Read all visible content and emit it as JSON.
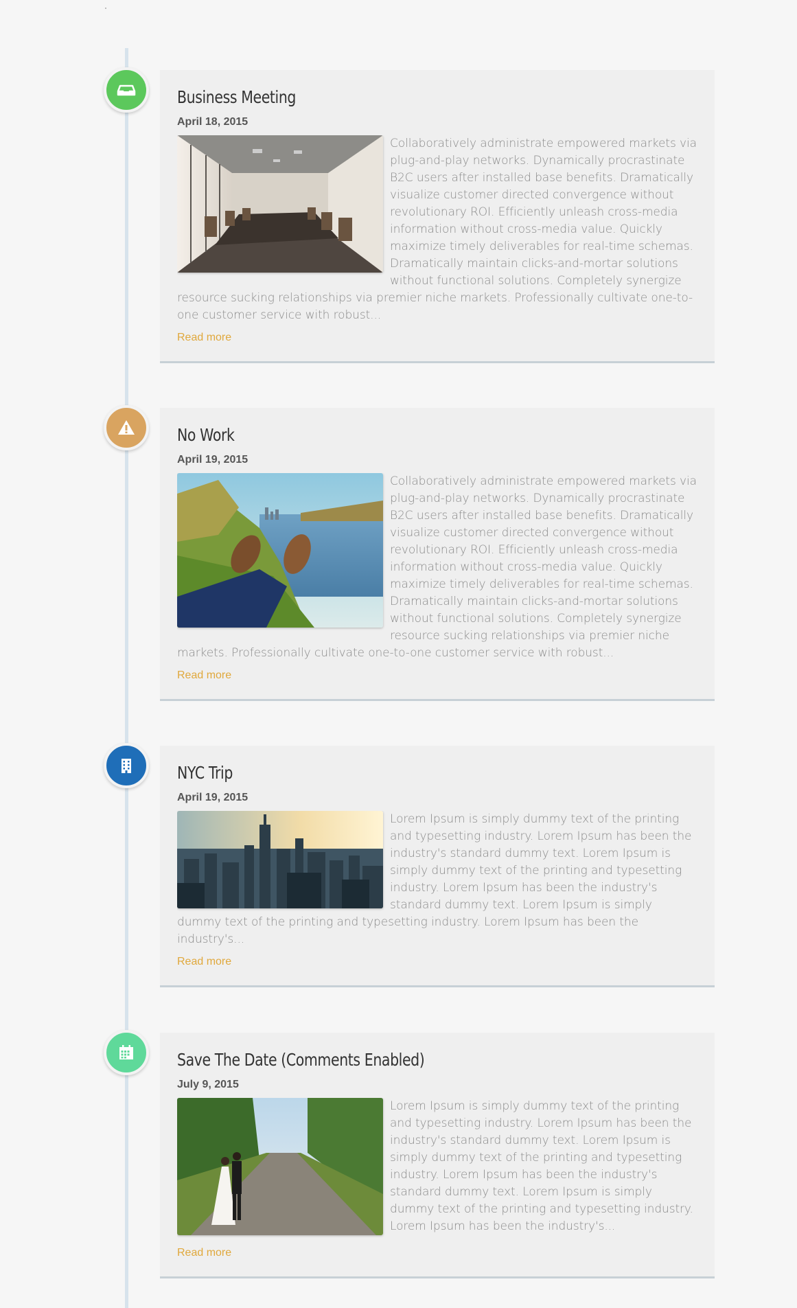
{
  "posts": [
    {
      "icon": "inbox-icon",
      "icon_color": "#5cc85c",
      "title": "Business Meeting",
      "date": "April 18, 2015",
      "image": "conference-room-photo",
      "excerpt": "Collaboratively administrate empowered markets via plug-and-play networks. Dynamically procrastinate B2C users after installed base benefits. Dramatically visualize customer directed convergence without revolutionary ROI. Efficiently unleash cross-media information without cross-media value. Quickly maximize timely deliverables for real-time schemas. Dramatically maintain clicks-and-mortar solutions without functional solutions. Completely synergize resource sucking relationships via premier niche markets. Professionally cultivate one-to-one customer service with robust...",
      "read_more": "Read more"
    },
    {
      "icon": "warning-icon",
      "icon_color": "#d9a460",
      "title": "No Work",
      "date": "April 19, 2015",
      "image": "lakeside-boots-photo",
      "excerpt": "Collaboratively administrate empowered markets via plug-and-play networks. Dynamically procrastinate B2C users after installed base benefits. Dramatically visualize customer directed convergence without revolutionary ROI. Efficiently unleash cross-media information without cross-media value. Quickly maximize timely deliverables for real-time schemas. Dramatically maintain clicks-and-mortar solutions without functional solutions. Completely synergize resource sucking relationships via premier niche markets. Professionally cultivate one-to-one customer service with robust...",
      "read_more": "Read more"
    },
    {
      "icon": "building-icon",
      "icon_color": "#1f6eb8",
      "title": "NYC Trip",
      "date": "April 19, 2015",
      "image": "city-skyline-photo",
      "excerpt": "Lorem Ipsum is simply dummy text of the printing and typesetting industry. Lorem Ipsum has been the industry's standard dummy text. Lorem Ipsum is simply dummy text of the printing and typesetting industry. Lorem Ipsum has been the industry's standard dummy text. Lorem Ipsum is simply dummy text of the printing and typesetting industry. Lorem Ipsum has been the industry's...",
      "read_more": "Read more"
    },
    {
      "icon": "calendar-icon",
      "icon_color": "#5fd99a",
      "title": "Save The Date (Comments Enabled)",
      "date": "July 9, 2015",
      "image": "wedding-couple-photo",
      "excerpt": "Lorem Ipsum is simply dummy text of the printing and typesetting industry. Lorem Ipsum has been the industry's standard dummy text. Lorem Ipsum is simply dummy text of the printing and typesetting industry. Lorem Ipsum has been the industry's standard dummy text. Lorem Ipsum is simply dummy text of the printing and typesetting industry. Lorem Ipsum has been the industry's...",
      "read_more": "Read more"
    }
  ]
}
